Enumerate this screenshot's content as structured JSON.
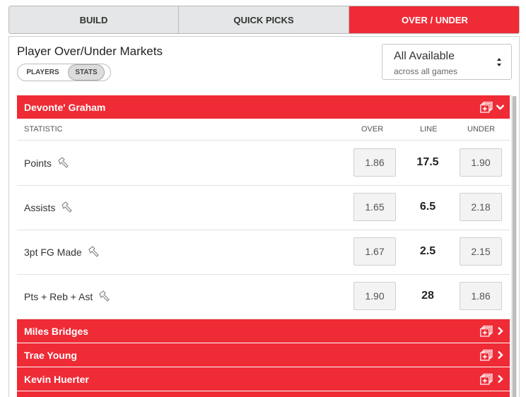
{
  "tabs": [
    {
      "label": "BUILD",
      "active": false
    },
    {
      "label": "QUICK PICKS",
      "active": false
    },
    {
      "label": "OVER / UNDER",
      "active": true
    }
  ],
  "panel": {
    "title": "Player Over/Under Markets",
    "toggle": {
      "options": [
        "PLAYERS",
        "STATS"
      ],
      "selected": "STATS"
    },
    "select": {
      "value": "All Available",
      "subtext": "across all games"
    }
  },
  "columns": {
    "statistic": "STATISTIC",
    "over": "OVER",
    "line": "LINE",
    "under": "UNDER"
  },
  "players": [
    {
      "name": "Devonte' Graham",
      "expanded": true,
      "rows": [
        {
          "stat": "Points",
          "over": "1.86",
          "line": "17.5",
          "under": "1.90"
        },
        {
          "stat": "Assists",
          "over": "1.65",
          "line": "6.5",
          "under": "2.18"
        },
        {
          "stat": "3pt FG Made",
          "over": "1.67",
          "line": "2.5",
          "under": "2.15"
        },
        {
          "stat": "Pts + Reb + Ast",
          "over": "1.90",
          "line": "28",
          "under": "1.86"
        }
      ]
    },
    {
      "name": "Miles Bridges",
      "expanded": false
    },
    {
      "name": "Trae Young",
      "expanded": false
    },
    {
      "name": "Kevin Huerter",
      "expanded": false
    }
  ],
  "colors": {
    "accent": "#ef2b36",
    "tab_bg": "#e4e6e7"
  },
  "icons": {
    "header_add": "add-to-slip-icon",
    "expanded": "chevron-down-icon",
    "collapsed": "chevron-right-icon",
    "stat": "hammer-icon",
    "select": "sort-arrows-icon"
  }
}
